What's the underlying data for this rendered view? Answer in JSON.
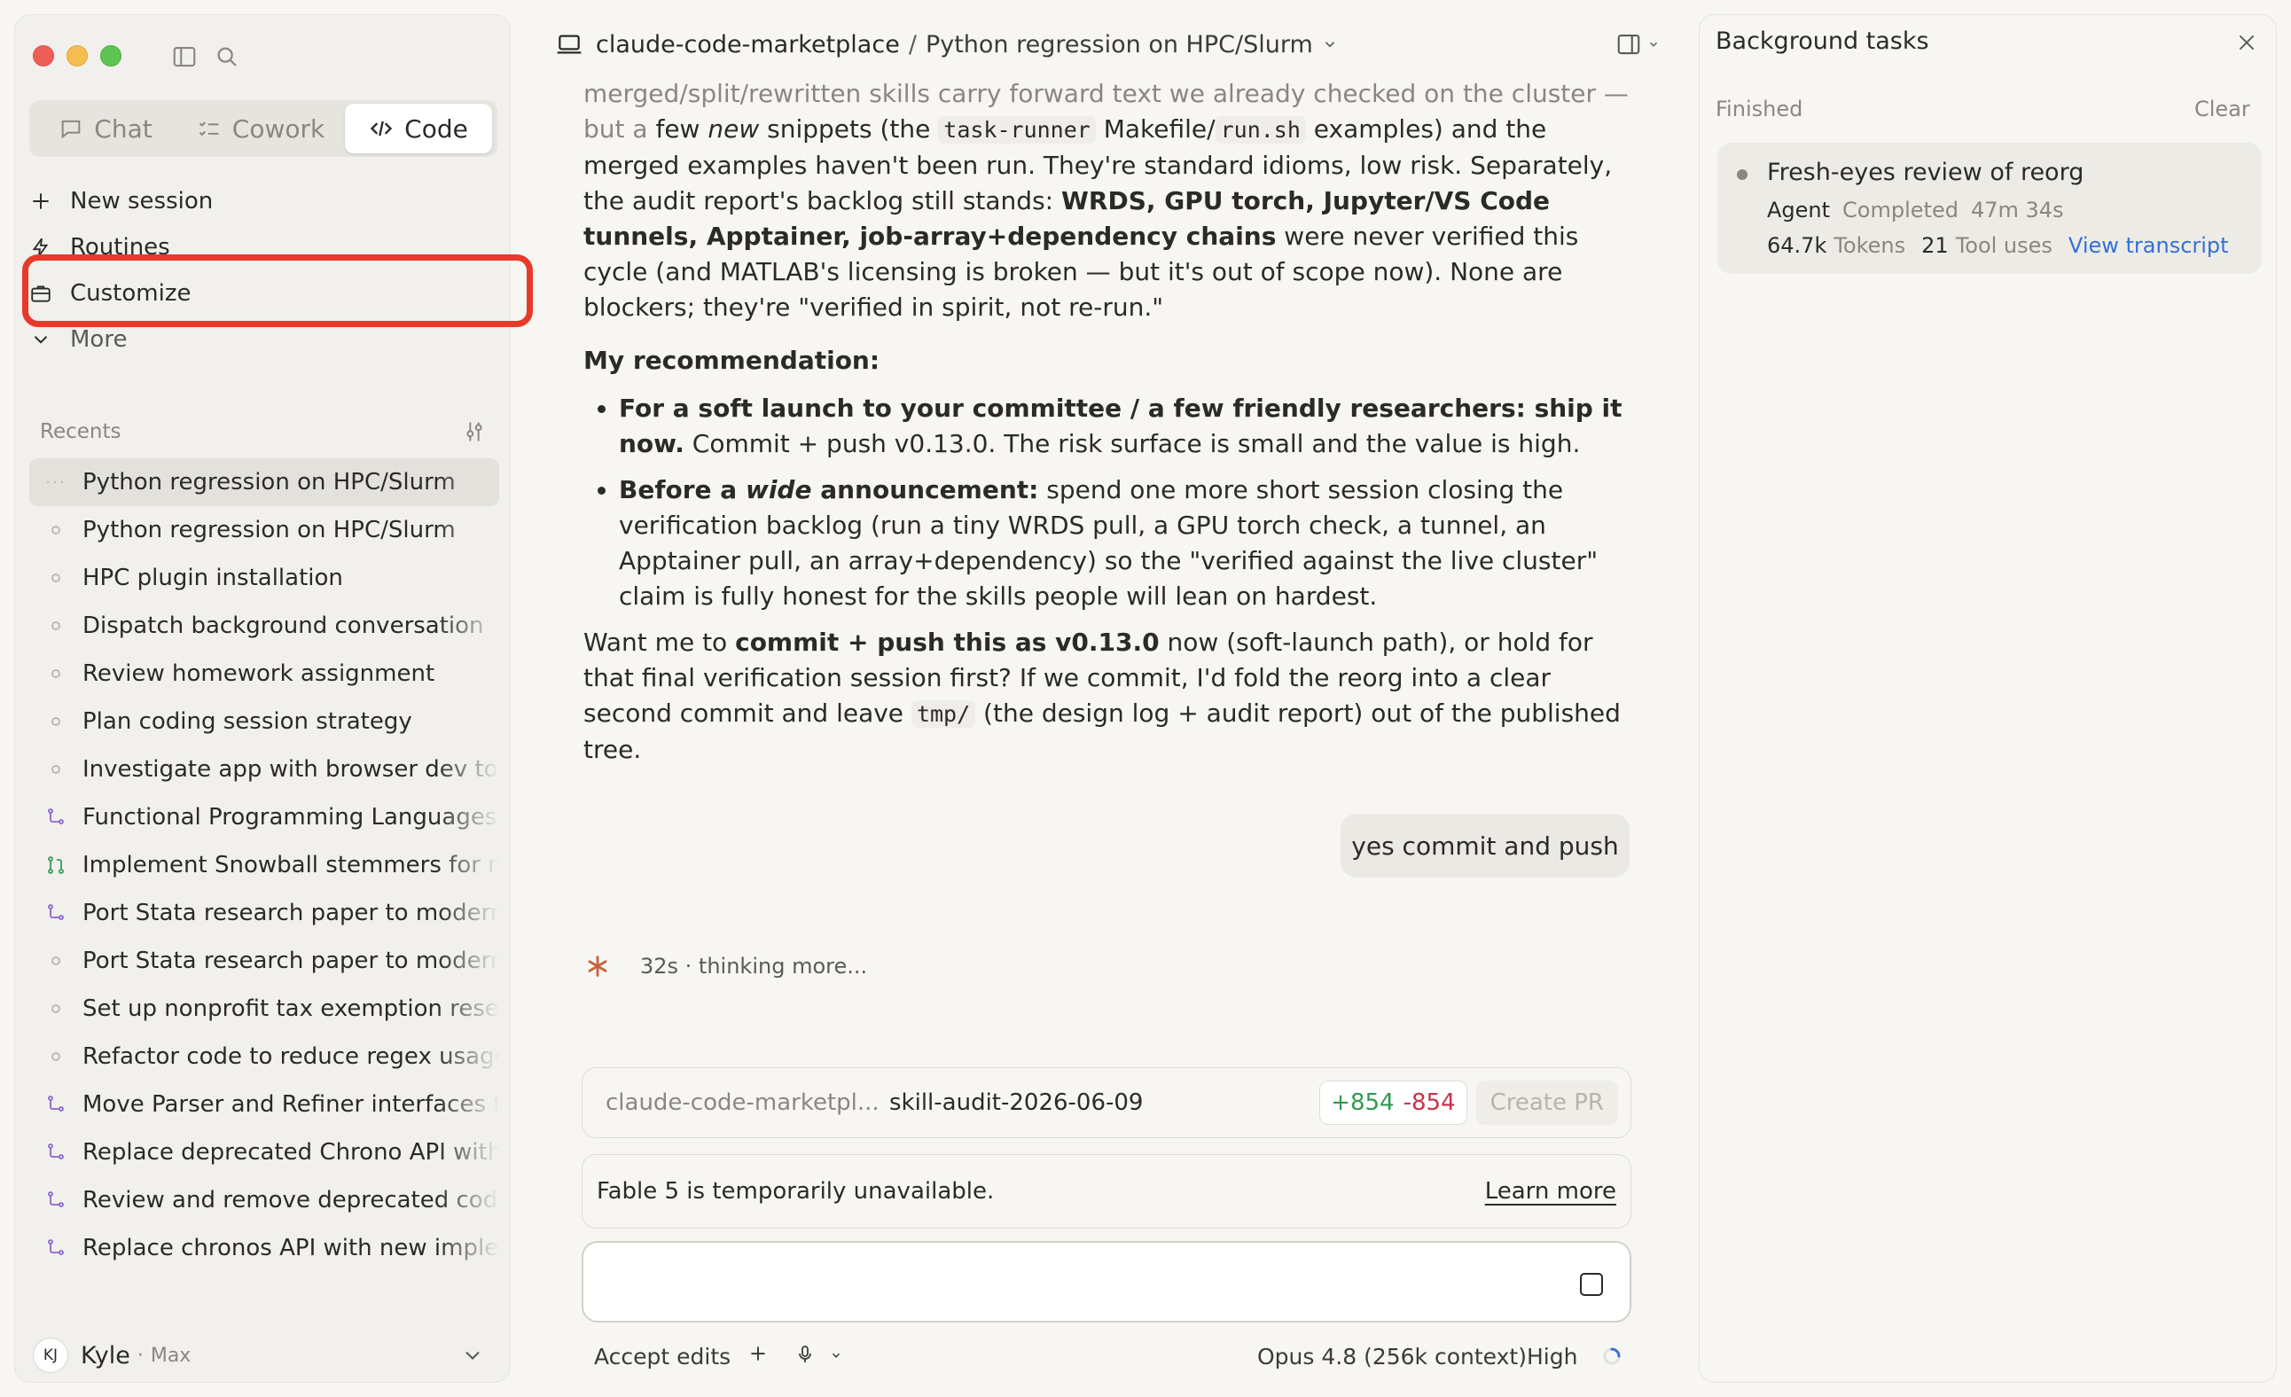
{
  "sidebar": {
    "modes": [
      {
        "label": "Chat",
        "icon": "chat-icon"
      },
      {
        "label": "Cowork",
        "icon": "checklist-icon"
      },
      {
        "label": "Code",
        "icon": "code-icon"
      }
    ],
    "active_mode": "Code",
    "menu": [
      {
        "label": "New session",
        "icon": "plus-icon"
      },
      {
        "label": "Routines",
        "icon": "bolt-icon"
      },
      {
        "label": "Customize",
        "icon": "briefcase-icon"
      },
      {
        "label": "More",
        "icon": "chevron-down-icon"
      }
    ],
    "recents_label": "Recents",
    "recents": [
      {
        "label": "Python regression on HPC/Slurm",
        "icon": "ellipsis-icon",
        "active": true
      },
      {
        "label": "Python regression on HPC/Slurm",
        "icon": "circle-icon"
      },
      {
        "label": "HPC plugin installation",
        "icon": "circle-icon"
      },
      {
        "label": "Dispatch background conversation",
        "icon": "circle-icon"
      },
      {
        "label": "Review homework assignment",
        "icon": "circle-icon"
      },
      {
        "label": "Plan coding session strategy",
        "icon": "circle-icon"
      },
      {
        "label": "Investigate app with browser dev tools",
        "icon": "circle-icon"
      },
      {
        "label": "Functional Programming Languages E",
        "icon": "branch-icon"
      },
      {
        "label": "Implement Snowball stemmers for mu",
        "icon": "pull-request-icon"
      },
      {
        "label": "Port Stata research paper to modern",
        "icon": "branch-icon"
      },
      {
        "label": "Port Stata research paper to modern",
        "icon": "circle-icon"
      },
      {
        "label": "Set up nonprofit tax exemption resea",
        "icon": "circle-icon"
      },
      {
        "label": "Refactor code to reduce regex usage",
        "icon": "circle-icon"
      },
      {
        "label": "Move Parser and Refiner interfaces to",
        "icon": "branch-icon"
      },
      {
        "label": "Replace deprecated Chrono API with",
        "icon": "branch-icon"
      },
      {
        "label": "Review and remove deprecated code",
        "icon": "branch-icon"
      },
      {
        "label": "Replace chronos API with new implen",
        "icon": "branch-icon"
      }
    ],
    "user": {
      "initials": "KJ",
      "name": "Kyle",
      "separator": "·",
      "plan": "Max"
    }
  },
  "header": {
    "project": "claude-code-marketplace",
    "separator": "/",
    "session": "Python regression on HPC/Slurm"
  },
  "transcript": {
    "p1_faded": "merged/split/rewritten skills carry forward text we already checked on the cluster — but a",
    "p1_a": "few ",
    "p1_em": "new",
    "p1_b": " snippets (the ",
    "p1_code1": "task-runner",
    "p1_c": " Makefile/",
    "p1_code2": "run.sh",
    "p1_d": " examples) and the merged examples haven't been run. They're standard idioms, low risk. Separately, the audit report's backlog still stands: ",
    "p1_bold": "WRDS, GPU torch, Jupyter/VS Code tunnels, Apptainer, job-array+dependency chains",
    "p1_e": " were never verified this cycle (and MATLAB's licensing is broken — but it's out of scope now). None are blockers; they're \"verified in spirit, not re-run.\"",
    "rec_heading": "My recommendation:",
    "b1_bold": "For a soft launch to your committee / a few friendly researchers: ship it now.",
    "b1_text": " Commit + push v0.13.0. The risk surface is small and the value is high.",
    "b2_bold_a": "Before a ",
    "b2_em": "wide",
    "b2_bold_b": " announcement:",
    "b2_text": " spend one more short session closing the verification backlog (run a tiny WRDS pull, a GPU torch check, a tunnel, an Apptainer pull, an array+dependency) so the \"verified against the live cluster\" claim is fully honest for the skills people will lean on hardest.",
    "p3_a": "Want me to ",
    "p3_bold": "commit + push this as v0.13.0",
    "p3_b": " now (soft-launch path), or hold for that final verification session first? If we commit, I'd fold the reorg into a clear second commit and leave ",
    "p3_code": "tmp/",
    "p3_c": " (the design log + audit report) out of the published tree.",
    "user_message": "yes commit and push",
    "thinking": "32s · thinking more..."
  },
  "branch_card": {
    "repo": "claude-code-marketpl...",
    "branch": "skill-audit-2026-06-09",
    "additions": "+854",
    "deletions": "-854",
    "create_pr": "Create PR"
  },
  "notice": {
    "text": "Fable 5 is temporarily unavailable.",
    "link": "Learn more"
  },
  "composer": {
    "value": "",
    "placeholder": ""
  },
  "bottom_bar": {
    "permission": "Accept edits",
    "model": "Opus 4.8 (256k context)",
    "effort": "High"
  },
  "background_tasks": {
    "title": "Background tasks",
    "section": "Finished",
    "clear": "Clear",
    "tasks": [
      {
        "name": "Fresh-eyes review of reorg",
        "type": "Agent",
        "status": "Completed",
        "duration": "47m 34s",
        "tokens_value": "64.7k",
        "tokens_label": "Tokens",
        "tool_uses_value": "21",
        "tool_uses_label": "Tool uses",
        "link": "View transcript"
      }
    ]
  },
  "colors": {
    "highlight": "#e8392a",
    "accent_star": "#c8623e",
    "link": "#3570d8",
    "additions": "#2f9a4e",
    "deletions": "#c9304a"
  }
}
